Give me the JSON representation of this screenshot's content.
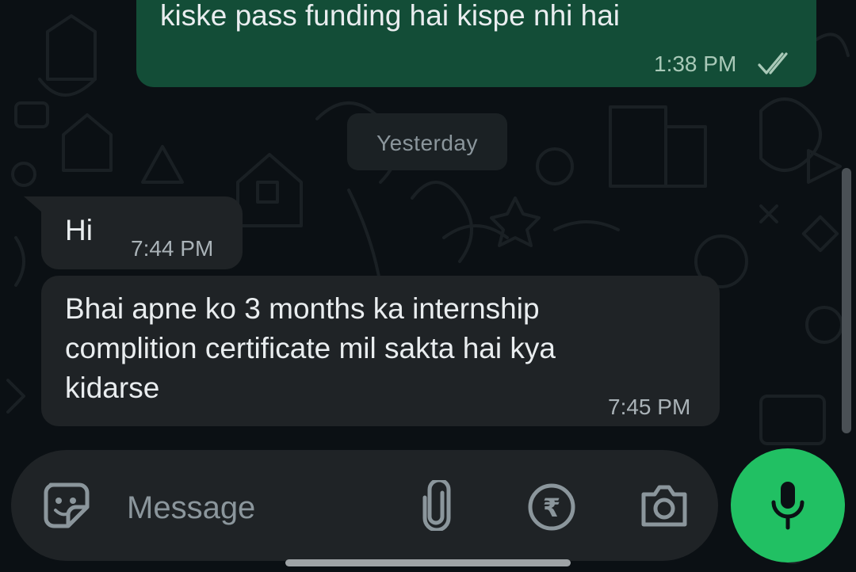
{
  "messages": [
    {
      "direction": "outgoing",
      "text": "kiske pass funding hai kispe nhi hai",
      "time": "1:38 PM",
      "status_icon": "double-check-icon"
    },
    {
      "direction": "incoming",
      "text": "Hi",
      "time": "7:44 PM"
    },
    {
      "direction": "incoming",
      "text_lines": [
        "Bhai apne ko 3 months ka internship",
        "complition certificate mil sakta hai kya",
        "kidarse"
      ],
      "time": "7:45 PM"
    }
  ],
  "date_separator": "Yesterday",
  "composer": {
    "placeholder": "Message",
    "icons": [
      "sticker-icon",
      "attach-icon",
      "payment-rupee-icon",
      "camera-icon"
    ],
    "send_icon": "microphone-icon"
  },
  "colors": {
    "background": "#0b1014",
    "outgoing_bubble": "#134d37",
    "incoming_bubble": "#1f2326",
    "accent": "#21c063"
  }
}
